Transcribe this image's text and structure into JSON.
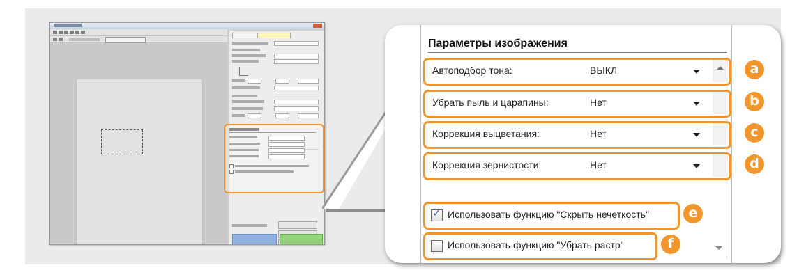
{
  "image_settings": {
    "group_title": "Параметры изображения",
    "rows": [
      {
        "label": "Автоподбор тона:",
        "value": "ВЫКЛ",
        "badge": "a"
      },
      {
        "label": "Убрать пыль и царапины:",
        "value": "Нет",
        "badge": "b"
      },
      {
        "label": "Коррекция выцветания:",
        "value": "Нет",
        "badge": "c"
      },
      {
        "label": "Коррекция зернистости:",
        "value": "Нет",
        "badge": "d"
      }
    ],
    "checkboxes": [
      {
        "label": "Использовать функцию \"Скрыть нечеткость\"",
        "checked": true,
        "badge": "e"
      },
      {
        "label": "Использовать функцию \"Убрать растр\"",
        "checked": false,
        "badge": "f"
      }
    ]
  },
  "colors": {
    "highlight": "#f0962c",
    "badge_text": "#ffffff",
    "checkmark": "#2c5fa8"
  }
}
